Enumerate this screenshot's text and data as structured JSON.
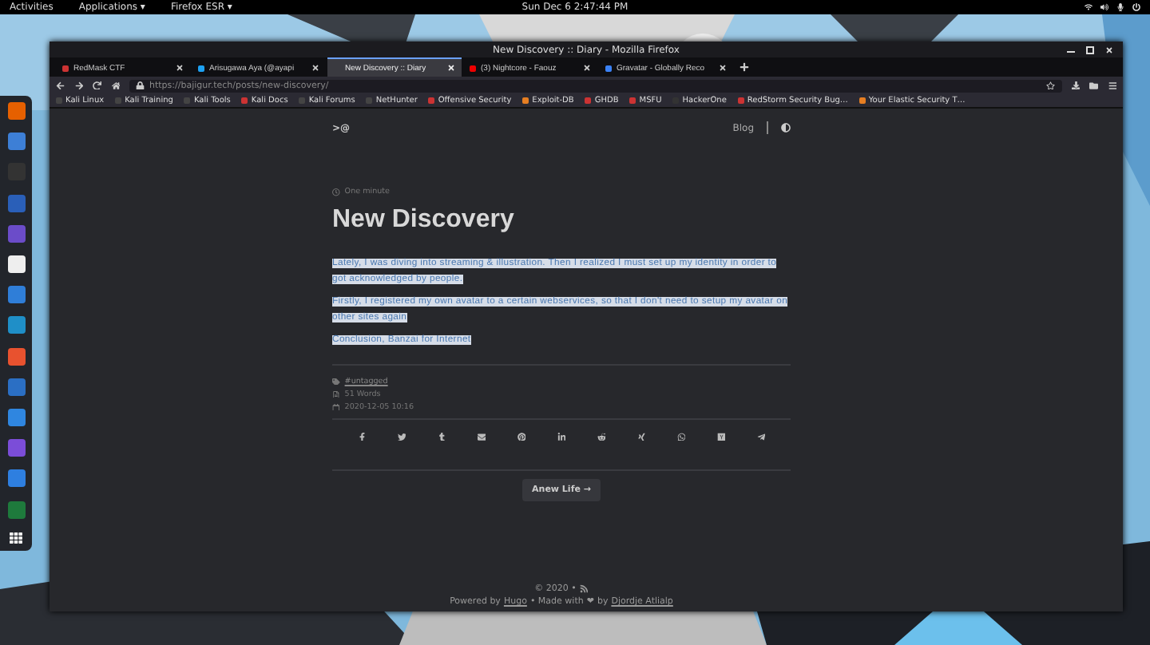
{
  "top_bar": {
    "activities": "Activities",
    "applications": "Applications ▾",
    "app_menu": "Firefox ESR ▾",
    "clock": "Sun Dec 6   2:47:44 PM"
  },
  "browser": {
    "window_title": "New Discovery :: Diary - Mozilla Firefox",
    "tabs": [
      {
        "title": "RedMask CTF",
        "selected": false
      },
      {
        "title": "Arisugawa Aya (@ayapi",
        "selected": false
      },
      {
        "title": "New Discovery :: Diary",
        "selected": true
      },
      {
        "title": "(3) Nightcore - Faouz",
        "selected": false
      },
      {
        "title": "Gravatar - Globally Reco",
        "selected": false
      }
    ],
    "url_host": "https://bajigur.tech",
    "url_path": "/posts/new-discovery/",
    "bookmarks": [
      "Kali Linux",
      "Kali Training",
      "Kali Tools",
      "Kali Docs",
      "Kali Forums",
      "NetHunter",
      "Offensive Security",
      "Exploit-DB",
      "GHDB",
      "MSFU",
      "HackerOne",
      "RedStorm Security Bug…",
      "Your Elastic Security T…"
    ]
  },
  "page": {
    "logo": ">@",
    "nav": [
      "Blog"
    ],
    "reading_time": "One minute",
    "title": "New Discovery",
    "paragraphs": [
      {
        "text": "Lately, I was diving into streaming & illustration. Then I realized I must set up my identity in order to got acknowledged by people.",
        "highlighted": true
      },
      {
        "text": "Firstly, I registered my own avatar to a certain webservices, so that I don't need to setup my avatar on other sites again",
        "highlighted": true
      },
      {
        "text": "Conclusion, Banzai for Internet",
        "highlighted": true
      }
    ],
    "tag": "#untagged",
    "words": "51 Words",
    "date": "2020-12-05 10:16",
    "next_post": "Anew Life →",
    "footer": {
      "copyright": "© 2020 •",
      "powered_by": "Powered by",
      "hugo": "Hugo",
      "made_with": "• Made with",
      "heart": "❤",
      "by": "by",
      "author": "Djordje Atlialp"
    }
  }
}
